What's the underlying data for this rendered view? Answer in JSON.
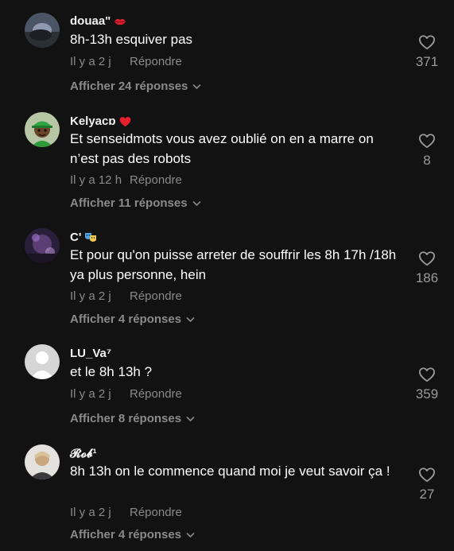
{
  "comments": [
    {
      "username": "douaa\"",
      "badge_icon": "red-lips-emoji-icon",
      "text": "8h-13h esquiver pas",
      "time": "Il y a 2 j",
      "reply_label": "Répondre",
      "replies_label": "Afficher 24 réponses",
      "likes": "371"
    },
    {
      "username": "Kelyacɒ",
      "badge_icon": "red-heart-emoji-icon",
      "text": "Et senseidmots vous avez oublié on en a marre on n’est pas des robots",
      "time": "Il y a 12 h",
      "reply_label": "Répondre",
      "replies_label": "Afficher 11 réponses",
      "likes": "8"
    },
    {
      "username": "C'",
      "badge_icon": "theater-masks-emoji-icon",
      "text": "Et pour qu'on puisse arreter de souffrir les 8h 17h /18h ya plus personne, hein",
      "time": "Il y a 2 j",
      "reply_label": "Répondre",
      "replies_label": "Afficher 4 réponses",
      "likes": "186"
    },
    {
      "username": "LU_Va⁷",
      "badge_icon": "",
      "text": "et le 8h 13h ?",
      "time": "Il y a 2 j",
      "reply_label": "Répondre",
      "replies_label": "Afficher 8 réponses",
      "likes": "359"
    },
    {
      "username": "𝓡𝓸𝓫¹",
      "badge_icon": "",
      "text": "8h 13h on le commence quand moi je veut savoir ça !",
      "time": "Il y a 2 j",
      "reply_label": "Répondre",
      "replies_label": "Afficher 4 réponses",
      "likes": "27"
    }
  ],
  "colors": {
    "background": "#121212",
    "text": "#ffffff",
    "muted": "#8a8a8a"
  }
}
